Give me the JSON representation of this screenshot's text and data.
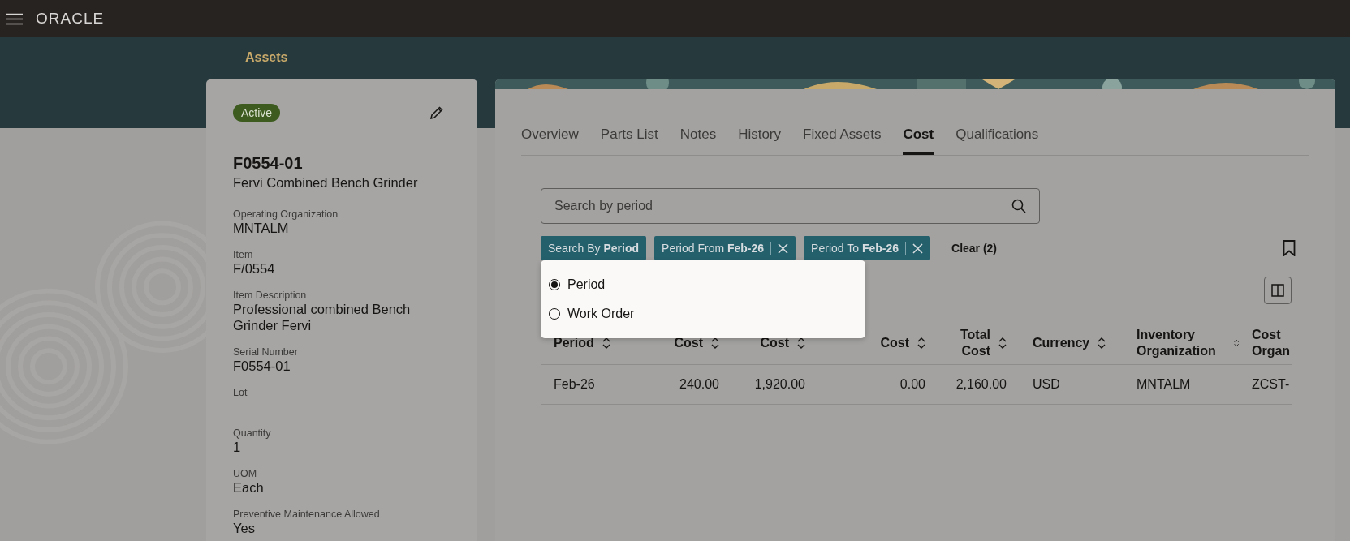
{
  "app_bar": {
    "logo": "ORACLE"
  },
  "page_title": "Assets",
  "asset_card": {
    "status": "Active",
    "number": "F0554-01",
    "name": "Fervi Combined Bench Grinder",
    "fields": [
      {
        "label": "Operating Organization",
        "value": "MNTALM"
      },
      {
        "label": "Item",
        "value": "F/0554"
      },
      {
        "label": "Item Description",
        "value": "Professional combined Bench Grinder Fervi"
      },
      {
        "label": "Serial Number",
        "value": "F0554-01"
      },
      {
        "label": "Lot"
      },
      {
        "label": "Quantity",
        "value": "1"
      },
      {
        "label": "UOM",
        "value": "Each"
      },
      {
        "label": "Preventive Maintenance Allowed",
        "value": "Yes"
      }
    ]
  },
  "tabs": [
    {
      "label": "Overview",
      "selected": false
    },
    {
      "label": "Parts List",
      "selected": false
    },
    {
      "label": "Notes",
      "selected": false
    },
    {
      "label": "History",
      "selected": false
    },
    {
      "label": "Fixed Assets",
      "selected": false
    },
    {
      "label": "Cost",
      "selected": true
    },
    {
      "label": "Qualifications",
      "selected": false
    }
  ],
  "search": {
    "placeholder": "Search by period"
  },
  "filter_chips": [
    {
      "label": "Search By",
      "value": "Period",
      "removable": false
    },
    {
      "label": "Period From",
      "value": "Feb-26",
      "removable": true
    },
    {
      "label": "Period To",
      "value": "Feb-26",
      "removable": true
    }
  ],
  "clear_link": "Clear (2)",
  "search_by_menu": [
    {
      "label": "Period",
      "selected": true
    },
    {
      "label": "Work Order",
      "selected": false
    }
  ],
  "table": {
    "columns": [
      {
        "label": "Period"
      },
      {
        "label": "Cost"
      },
      {
        "label": "Cost"
      },
      {
        "label": "Cost"
      },
      {
        "label": "Total Cost"
      },
      {
        "label": "Currency"
      },
      {
        "label": "Inventory Organization"
      },
      {
        "label": "Cost Organ"
      }
    ],
    "rows": [
      [
        "Feb-26",
        "240.00",
        "1,920.00",
        "0.00",
        "2,160.00",
        "USD",
        "MNTALM",
        "ZCST-"
      ]
    ]
  }
}
